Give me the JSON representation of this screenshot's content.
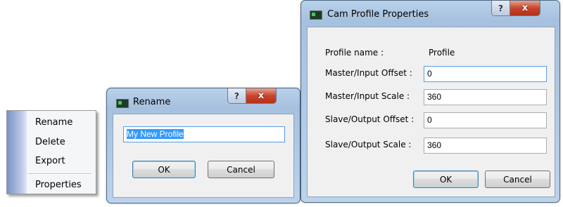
{
  "context_menu": {
    "items": [
      {
        "label": "Rename"
      },
      {
        "label": "Delete"
      },
      {
        "label": "Export"
      },
      {
        "label": "Properties"
      }
    ]
  },
  "rename_dialog": {
    "title": "Rename",
    "help_label": "?",
    "close_label": "x",
    "name_value": "My New Profile",
    "ok_label": "OK",
    "cancel_label": "Cancel"
  },
  "properties_dialog": {
    "title": "Cam Profile Properties",
    "help_label": "?",
    "close_label": "x",
    "profile_name_label": "Profile name :",
    "profile_name_value": "Profile",
    "fields": [
      {
        "label": "Master/Input Offset :",
        "value": "0"
      },
      {
        "label": "Master/Input Scale :",
        "value": "360"
      },
      {
        "label": "Slave/Output Offset :",
        "value": "0"
      },
      {
        "label": "Slave/Output Scale :",
        "value": "360"
      }
    ],
    "ok_label": "OK",
    "cancel_label": "Cancel"
  }
}
